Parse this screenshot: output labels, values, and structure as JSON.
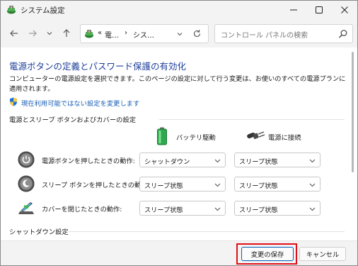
{
  "window": {
    "title": "システム設定",
    "app_icon": "power-options-icon",
    "controls": [
      "minimize-icon",
      "maximize-icon",
      "close-icon"
    ]
  },
  "nav": {
    "back_icon": "back-arrow-icon",
    "forward_icon": "forward-arrow-icon",
    "recent_icon": "chevron-down-icon",
    "up_icon": "up-arrow-icon",
    "refresh_icon": "refresh-icon",
    "address": {
      "prefix": "«",
      "crumbs": [
        "電…",
        "シス…"
      ],
      "separator": "›"
    },
    "search": {
      "placeholder": "コントロール パネルの検索",
      "icon": "search-icon"
    }
  },
  "content": {
    "heading": "電源ボタンの定義とパスワード保護の有効化",
    "description": "コンピューターの電源設定を選択できます。このページの設定に対して行う変更は、お使いのすべての電源プランに適用されます。",
    "admin_link": "現在利用可能ではない設定を変更します",
    "section_power": "電源とスリープ ボタンおよびカバーの設定",
    "columns": [
      {
        "label": "バッテリ駆動",
        "icon": "battery-icon"
      },
      {
        "label": "電源に接続",
        "icon": "power-plug-icon"
      }
    ],
    "rows": [
      {
        "label": "電源ボタンを押したときの動作:",
        "icon": "power-button-icon",
        "battery": "シャットダウン",
        "plugged": "スリープ状態"
      },
      {
        "label": "スリープ ボタンを押したときの動作:",
        "icon": "sleep-button-icon",
        "battery": "スリープ状態",
        "plugged": "スリープ状態"
      },
      {
        "label": "カバーを閉じたときの動作:",
        "icon": "laptop-lid-icon",
        "battery": "スリープ状態",
        "plugged": "スリープ状態"
      }
    ],
    "section_shutdown": "シャットダウン設定"
  },
  "footer": {
    "save_label": "変更の保存",
    "cancel_label": "キャンセル"
  },
  "colors": {
    "heading": "#1f3f9a",
    "link": "#1a5fb4",
    "highlight": "#e0101a",
    "primary_border": "#005fb8"
  }
}
